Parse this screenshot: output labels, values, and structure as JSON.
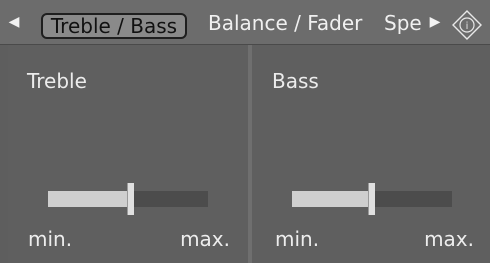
{
  "tabs": {
    "treble_bass": "Treble / Bass",
    "balance_fader": "Balance / Fader",
    "speed_partial": "Spe"
  },
  "icons": {
    "left": "left-arrow-icon",
    "right": "right-arrow-icon",
    "info": "info-icon"
  },
  "treble": {
    "title": "Treble",
    "min": "min.",
    "max": "max.",
    "level": 0.5
  },
  "bass": {
    "title": "Bass",
    "min": "min.",
    "max": "max.",
    "level": 0.48
  },
  "colors": {
    "background": "#5e5e5e",
    "active_tab": "#8a8a8a",
    "slider_fill": "#cfcfcf",
    "slider_track": "#4c4c4c"
  }
}
